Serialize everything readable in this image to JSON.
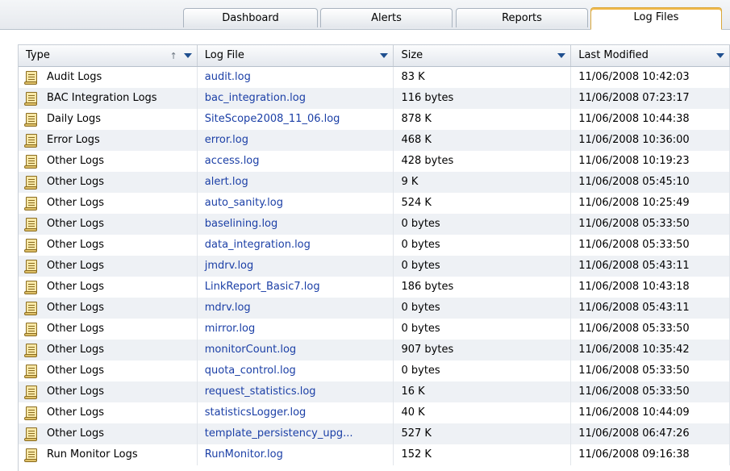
{
  "tabs": [
    {
      "label": "Dashboard",
      "active": false
    },
    {
      "label": "Alerts",
      "active": false
    },
    {
      "label": "Reports",
      "active": false
    },
    {
      "label": "Log Files",
      "active": true
    }
  ],
  "table": {
    "columns": [
      "Type",
      "Log File",
      "Size",
      "Last Modified"
    ],
    "rows": [
      {
        "type": "Audit Logs",
        "file": "audit.log",
        "size": "83 K",
        "modified": "11/06/2008 10:42:03"
      },
      {
        "type": "BAC Integration Logs",
        "file": "bac_integration.log",
        "size": "116 bytes",
        "modified": "11/06/2008 07:23:17"
      },
      {
        "type": "Daily Logs",
        "file": "SiteScope2008_11_06.log",
        "size": "878 K",
        "modified": "11/06/2008 10:44:38"
      },
      {
        "type": "Error Logs",
        "file": "error.log",
        "size": "468 K",
        "modified": "11/06/2008 10:36:00"
      },
      {
        "type": "Other Logs",
        "file": "access.log",
        "size": "428 bytes",
        "modified": "11/06/2008 10:19:23"
      },
      {
        "type": "Other Logs",
        "file": "alert.log",
        "size": "9 K",
        "modified": "11/06/2008 05:45:10"
      },
      {
        "type": "Other Logs",
        "file": "auto_sanity.log",
        "size": "524 K",
        "modified": "11/06/2008 10:25:49"
      },
      {
        "type": "Other Logs",
        "file": "baselining.log",
        "size": "0 bytes",
        "modified": "11/06/2008 05:33:50"
      },
      {
        "type": "Other Logs",
        "file": "data_integration.log",
        "size": "0 bytes",
        "modified": "11/06/2008 05:33:50"
      },
      {
        "type": "Other Logs",
        "file": "jmdrv.log",
        "size": "0 bytes",
        "modified": "11/06/2008 05:43:11"
      },
      {
        "type": "Other Logs",
        "file": "LinkReport_Basic7.log",
        "size": "186 bytes",
        "modified": "11/06/2008 10:43:18"
      },
      {
        "type": "Other Logs",
        "file": "mdrv.log",
        "size": "0 bytes",
        "modified": "11/06/2008 05:43:11"
      },
      {
        "type": "Other Logs",
        "file": "mirror.log",
        "size": "0 bytes",
        "modified": "11/06/2008 05:33:50"
      },
      {
        "type": "Other Logs",
        "file": "monitorCount.log",
        "size": "907 bytes",
        "modified": "11/06/2008 10:35:42"
      },
      {
        "type": "Other Logs",
        "file": "quota_control.log",
        "size": "0 bytes",
        "modified": "11/06/2008 05:33:50"
      },
      {
        "type": "Other Logs",
        "file": "request_statistics.log",
        "size": "16 K",
        "modified": "11/06/2008 05:33:50"
      },
      {
        "type": "Other Logs",
        "file": "statisticsLogger.log",
        "size": "40 K",
        "modified": "11/06/2008 10:44:09"
      },
      {
        "type": "Other Logs",
        "file": "template_persistency_upg...",
        "size": "527 K",
        "modified": "11/06/2008 06:47:26"
      },
      {
        "type": "Run Monitor Logs",
        "file": "RunMonitor.log",
        "size": "152 K",
        "modified": "11/06/2008 09:16:38"
      }
    ]
  },
  "icons": {
    "row_icon": "log-file-icon",
    "sort_icon": "sort-ascending-icon",
    "filter_icon": "filter-dropdown-icon"
  },
  "colors": {
    "link": "#1b3fa6",
    "active_tab_border": "#d9a73a"
  }
}
